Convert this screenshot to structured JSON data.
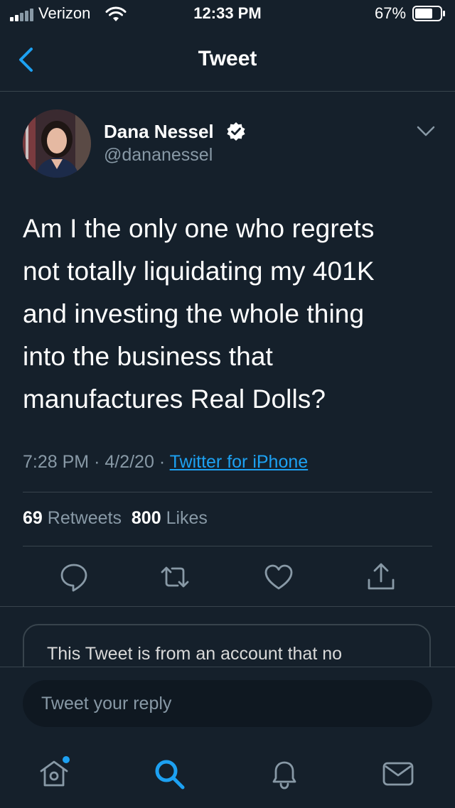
{
  "status_bar": {
    "carrier": "Verizon",
    "time": "12:33 PM",
    "battery": "67%"
  },
  "nav": {
    "title": "Tweet"
  },
  "tweet": {
    "author_name": "Dana Nessel",
    "author_handle": "@dananessel",
    "text": "Am I the only one who regrets\nnot totally liquidating my 401K\nand investing the whole thing\ninto the business that\nmanufactures Real Dolls?",
    "time": "7:28 PM",
    "date": "4/2/20",
    "separator": "·",
    "source": "Twitter for iPhone",
    "retweets_count": "69",
    "retweets_label": "Retweets",
    "likes_count": "800",
    "likes_label": "Likes"
  },
  "notice": {
    "text": "This Tweet is from an account that no"
  },
  "reply": {
    "placeholder": "Tweet your reply"
  },
  "colors": {
    "background": "#15202b",
    "accent": "#1da1f2",
    "secondary_text": "#8899a6",
    "border": "#38444d"
  },
  "icons": {
    "actions": [
      "reply-icon",
      "retweet-icon",
      "like-icon",
      "share-icon"
    ],
    "tabs": [
      "home-icon",
      "search-icon",
      "notifications-icon",
      "messages-icon"
    ]
  }
}
